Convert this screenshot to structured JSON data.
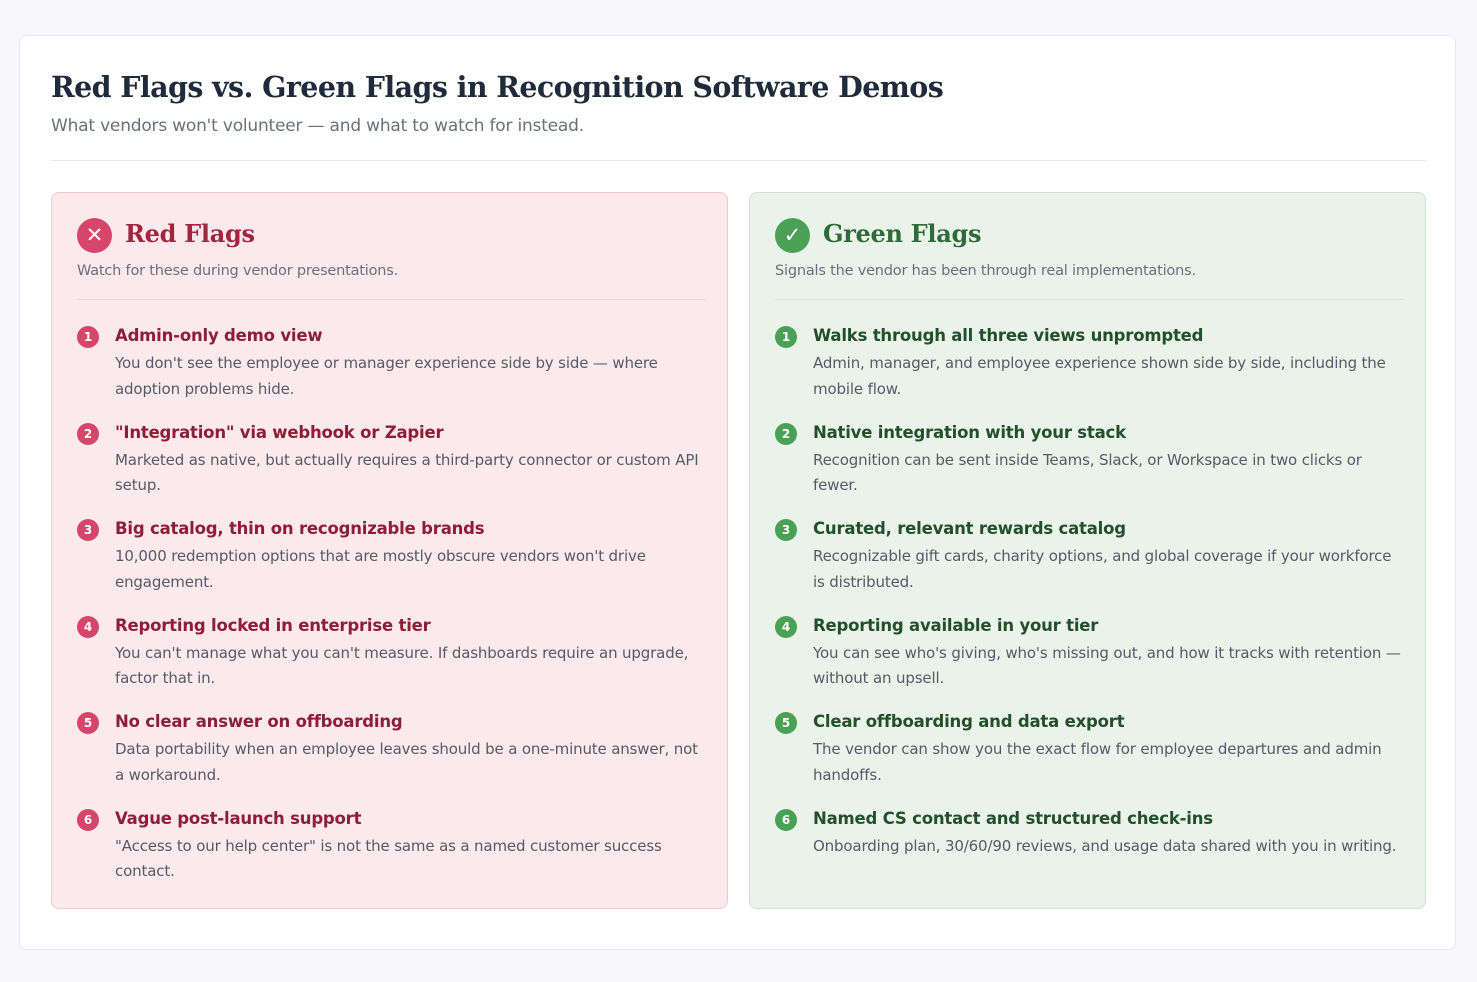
{
  "header": {
    "title": "Red Flags vs. Green Flags in Recognition Software Demos",
    "subtitle": "What vendors won't volunteer — and what to watch for instead."
  },
  "red": {
    "icon": "x-icon",
    "icon_glyph": "✕",
    "color": "#d6466a",
    "title": "Red Flags",
    "description": "Watch for these during vendor presentations.",
    "items": [
      {
        "num": "1",
        "title": "Admin-only demo view",
        "desc": "You don't see the employee or manager experience side by side — where adoption problems hide."
      },
      {
        "num": "2",
        "title": "\"Integration\" via webhook or Zapier",
        "desc": "Marketed as native, but actually requires a third-party connector or custom API setup."
      },
      {
        "num": "3",
        "title": "Big catalog, thin on recognizable brands",
        "desc": "10,000 redemption options that are mostly obscure vendors won't drive engagement."
      },
      {
        "num": "4",
        "title": "Reporting locked in enterprise tier",
        "desc": "You can't manage what you can't measure. If dashboards require an upgrade, factor that in."
      },
      {
        "num": "5",
        "title": "No clear answer on offboarding",
        "desc": "Data portability when an employee leaves should be a one-minute answer, not a workaround."
      },
      {
        "num": "6",
        "title": "Vague post-launch support",
        "desc": "\"Access to our help center\" is not the same as a named customer success contact."
      }
    ]
  },
  "green": {
    "icon": "check-icon",
    "icon_glyph": "✓",
    "color": "#4aa055",
    "title": "Green Flags",
    "description": "Signals the vendor has been through real implementations.",
    "items": [
      {
        "num": "1",
        "title": "Walks through all three views unprompted",
        "desc": "Admin, manager, and employee experience shown side by side, including the mobile flow."
      },
      {
        "num": "2",
        "title": "Native integration with your stack",
        "desc": "Recognition can be sent inside Teams, Slack, or Workspace in two clicks or fewer."
      },
      {
        "num": "3",
        "title": "Curated, relevant rewards catalog",
        "desc": "Recognizable gift cards, charity options, and global coverage if your workforce is distributed."
      },
      {
        "num": "4",
        "title": "Reporting available in your tier",
        "desc": "You can see who's giving, who's missing out, and how it tracks with retention — without an upsell."
      },
      {
        "num": "5",
        "title": "Clear offboarding and data export",
        "desc": "The vendor can show you the exact flow for employee departures and admin handoffs."
      },
      {
        "num": "6",
        "title": "Named CS contact and structured check-ins",
        "desc": "Onboarding plan, 30/60/90 reviews, and usage data shared with you in writing."
      }
    ]
  }
}
